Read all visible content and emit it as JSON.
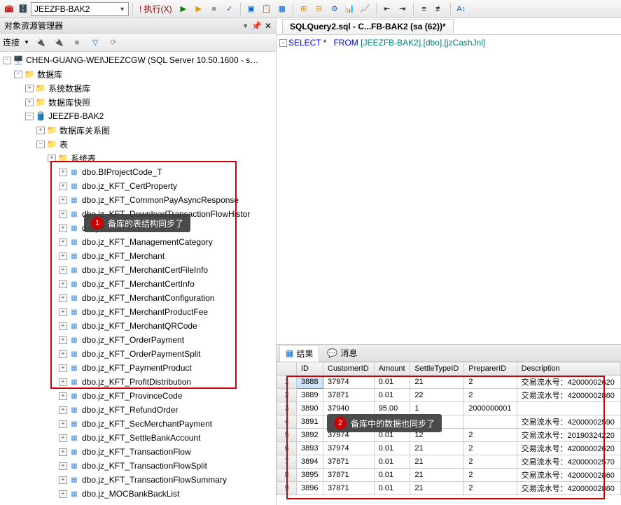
{
  "toolbar": {
    "db_name": "JEEZFB-BAK2",
    "execute_label": "执行(X)"
  },
  "explorer": {
    "title": "对象资源管理器",
    "connect_label": "连接",
    "server": "CHEN-GUANG-WEI\\JEEZCGW (SQL Server 10.50.1600 - s…",
    "db_folder": "数据库",
    "sys_db": "系统数据库",
    "db_snapshot": "数据库快照",
    "active_db": "JEEZFB-BAK2",
    "diagrams": "数据库关系图",
    "tables_folder": "表",
    "sys_tables": "系统表",
    "tables": [
      "dbo.BIProjectCode_T",
      "dbo.jz_KFT_CertProperty",
      "dbo.jz_KFT_CommonPayAsyncResponse",
      "dbo.jz_KFT_DownloadTransactionFlowHistor",
      "d o.j  K T…",
      "dbo.jz_KFT_ManagementCategory",
      "dbo.jz_KFT_Merchant",
      "dbo.jz_KFT_MerchantCertFileInfo",
      "dbo.jz_KFT_MerchantCertInfo",
      "dbo.jz_KFT_MerchantConfiguration",
      "dbo.jz_KFT_MerchantProductFee",
      "dbo.jz_KFT_MerchantQRCode",
      "dbo.jz_KFT_OrderPayment",
      "dbo.jz_KFT_OrderPaymentSplit",
      "dbo.jz_KFT_PaymentProduct",
      "dbo.jz_KFT_ProfitDistribution",
      "dbo.jz_KFT_ProvinceCode",
      "dbo.jz_KFT_RefundOrder",
      "dbo.jz_KFT_SecMerchantPayment",
      "dbo.jz_KFT_SettleBankAccount",
      "dbo.jz_KFT_TransactionFlow",
      "dbo.jz_KFT_TransactionFlowSplit",
      "dbo.jz_KFT_TransactionFlowSummary",
      "dbo.jz_MOCBankBackList"
    ]
  },
  "annotations": {
    "a1": "备库的表结构同步了",
    "a2": "备库中的数据也同步了"
  },
  "query": {
    "tab_title": "SQLQuery2.sql - C...FB-BAK2 (sa (62))*",
    "sql_select": "SELECT",
    "sql_star": " * ",
    "sql_from": "  FROM",
    "sql_object": " [JEEZFB-BAK2].[dbo].[jzCashJnl]"
  },
  "results": {
    "tab_results": "结果",
    "tab_messages": "消息",
    "columns": [
      "ID",
      "CustomerID",
      "Amount",
      "SettleTypeID",
      "PreparerID",
      "Description"
    ],
    "rows": [
      {
        "n": "1",
        "ID": "3888",
        "CustomerID": "37974",
        "Amount": "0.01",
        "SettleTypeID": "21",
        "PreparerID": "2",
        "Description": "交易流水号：42000002620"
      },
      {
        "n": "2",
        "ID": "3889",
        "CustomerID": "37871",
        "Amount": "0.01",
        "SettleTypeID": "22",
        "PreparerID": "2",
        "Description": "交易流水号：42000002860"
      },
      {
        "n": "3",
        "ID": "3890",
        "CustomerID": "37940",
        "Amount": "95.00",
        "SettleTypeID": "1",
        "PreparerID": "2000000001",
        "Description": ""
      },
      {
        "n": "4",
        "ID": "3891",
        "CustomerID": "",
        "Amount": "",
        "SettleTypeID": "",
        "PreparerID": "",
        "Description": "交易流水号：42000002590"
      },
      {
        "n": "5",
        "ID": "3892",
        "CustomerID": "37974",
        "Amount": "0.01",
        "SettleTypeID": "12",
        "PreparerID": "2",
        "Description": "交易流水号：20190324220"
      },
      {
        "n": "6",
        "ID": "3893",
        "CustomerID": "37974",
        "Amount": "0.01",
        "SettleTypeID": "21",
        "PreparerID": "2",
        "Description": "交易流水号：42000002620"
      },
      {
        "n": "7",
        "ID": "3894",
        "CustomerID": "37871",
        "Amount": "0.01",
        "SettleTypeID": "21",
        "PreparerID": "2",
        "Description": "交易流水号：42000002570"
      },
      {
        "n": "8",
        "ID": "3895",
        "CustomerID": "37871",
        "Amount": "0.01",
        "SettleTypeID": "21",
        "PreparerID": "2",
        "Description": "交易流水号：42000002860"
      },
      {
        "n": "9",
        "ID": "3896",
        "CustomerID": "37871",
        "Amount": "0.01",
        "SettleTypeID": "21",
        "PreparerID": "2",
        "Description": "交易流水号：42000002860"
      }
    ]
  }
}
